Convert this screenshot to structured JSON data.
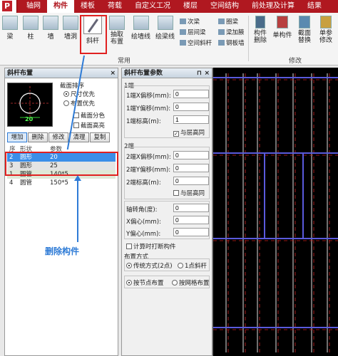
{
  "app": {
    "logo_letter": "P"
  },
  "tabs": [
    "轴网",
    "构件",
    "楼板",
    "荷载",
    "自定义工况",
    "楼层",
    "空间结构",
    "前处理及计算",
    "结果"
  ],
  "active_tab_index": 1,
  "ribbon": {
    "buttons": [
      {
        "label": "梁"
      },
      {
        "label": "柱"
      },
      {
        "label": "墙"
      },
      {
        "label": "墙洞"
      },
      {
        "label": "斜杆"
      },
      {
        "label": "抽取布置"
      },
      {
        "label": "绘墙线"
      },
      {
        "label": "绘梁线"
      }
    ],
    "small_items": [
      "次梁",
      "层间梁",
      "空间斜杆",
      "圈梁",
      "梁加腋",
      "钢板墙"
    ],
    "right_buttons": [
      {
        "label": "构件删除"
      },
      {
        "label": "单构件"
      },
      {
        "label": "截面替换"
      },
      {
        "label": "单参修改"
      }
    ],
    "groups": [
      "常用",
      "修改"
    ]
  },
  "brace_panel": {
    "title": "斜杆布置",
    "close": "×",
    "preview_label": "20",
    "sort_title": "截面排序",
    "sort_options": [
      "尺寸优先",
      "布置优先"
    ],
    "sort_selected": 0,
    "check_color": "截面分色",
    "check_height": "截面高亮",
    "buttons": [
      "增加",
      "删除",
      "修改",
      "清理",
      "复制"
    ],
    "columns": [
      "序",
      "形状",
      "参数"
    ],
    "rows": [
      {
        "no": "2",
        "shape": "圆形",
        "param": "20",
        "style": "sel"
      },
      {
        "no": "3",
        "shape": "圆形",
        "param": "25",
        "style": "grey"
      },
      {
        "no": "1",
        "shape": "圆管",
        "param": "140*5",
        "style": "green"
      },
      {
        "no": "4",
        "shape": "圆管",
        "param": "150*5",
        "style": ""
      }
    ],
    "callout": "删除构件"
  },
  "param_panel": {
    "title": "斜杆布置参数",
    "pin": "⊓",
    "close": "×",
    "end1_title": "1端",
    "end1": [
      {
        "label": "1端X偏移(mm):",
        "value": "0"
      },
      {
        "label": "1端Y偏移(mm):",
        "value": "0"
      },
      {
        "label": "1端标高(m):",
        "value": "1"
      }
    ],
    "end1_check": "与层高同",
    "end2_title": "2端",
    "end2": [
      {
        "label": "2端X偏移(mm):",
        "value": "0"
      },
      {
        "label": "2端Y偏移(mm):",
        "value": "0"
      },
      {
        "label": "2端标高(m):",
        "value": "0"
      }
    ],
    "end2_check": "与层高同",
    "misc": [
      {
        "label": "轴转角(度):",
        "value": "0"
      },
      {
        "label": "X偏心(mm):",
        "value": "0"
      },
      {
        "label": "Y偏心(mm):",
        "value": "0"
      }
    ],
    "calc_check": "计算时打断构件",
    "layout_title": "布置方式",
    "layout_options": [
      "传统方式(2点)",
      "1点斜杆"
    ],
    "layout_selected": 0,
    "node_options": [
      "按节点布置",
      "按网格布置"
    ],
    "node_selected": 0
  }
}
